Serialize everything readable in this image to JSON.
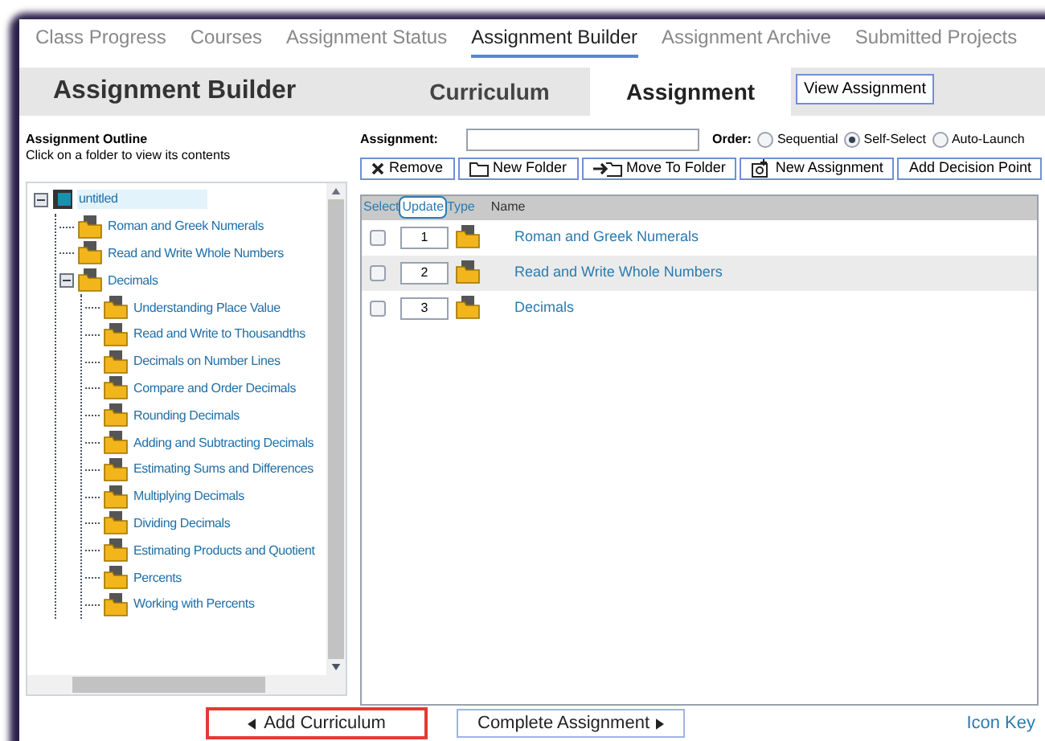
{
  "nav_tabs": [
    {
      "label": "Class Progress",
      "selected": false
    },
    {
      "label": "Courses",
      "selected": false
    },
    {
      "label": "Assignment Status",
      "selected": false
    },
    {
      "label": "Assignment Builder",
      "selected": true
    },
    {
      "label": "Assignment Archive",
      "selected": false
    },
    {
      "label": "Submitted Projects",
      "selected": false
    }
  ],
  "header": {
    "title": "Assignment Builder",
    "steps": [
      {
        "label": "Curriculum",
        "selected": false
      },
      {
        "label": "Assignment",
        "selected": true
      }
    ],
    "view_button": "View Assignment"
  },
  "outline": {
    "title": "Assignment Outline",
    "hint": "Click on a folder to view its contents",
    "tree": [
      {
        "label": "untitled",
        "kind": "root",
        "selected": true,
        "expanded": true,
        "children": [
          {
            "label": "Roman and Greek Numerals",
            "kind": "folder",
            "selected": false
          },
          {
            "label": "Read and Write Whole Numbers",
            "kind": "folder",
            "selected": false
          },
          {
            "label": "Decimals",
            "kind": "folder",
            "selected": false,
            "expanded": true,
            "children": [
              {
                "label": "Understanding Place Value",
                "kind": "folder",
                "selected": false
              },
              {
                "label": "Read and Write to Thousandths",
                "kind": "folder",
                "selected": false
              },
              {
                "label": "Decimals on Number Lines",
                "kind": "folder",
                "selected": false
              },
              {
                "label": "Compare and Order Decimals",
                "kind": "folder",
                "selected": false
              },
              {
                "label": "Rounding Decimals",
                "kind": "folder",
                "selected": false
              },
              {
                "label": "Adding and Subtracting Decimals",
                "kind": "folder",
                "selected": false
              },
              {
                "label": "Estimating Sums and Differences",
                "kind": "folder",
                "selected": false
              },
              {
                "label": "Multiplying Decimals",
                "kind": "folder",
                "selected": false
              },
              {
                "label": "Dividing Decimals",
                "kind": "folder",
                "selected": false
              },
              {
                "label": "Estimating Products and Quotient",
                "kind": "folder",
                "selected": false
              },
              {
                "label": "Percents",
                "kind": "folder",
                "selected": false
              },
              {
                "label": "Working with Percents",
                "kind": "folder",
                "selected": false
              }
            ]
          }
        ]
      }
    ]
  },
  "assignment": {
    "label": "Assignment:",
    "order_label": "Order:",
    "order_options": [
      {
        "label": "Sequential",
        "selected": false
      },
      {
        "label": "Self-Select",
        "selected": true
      },
      {
        "label": "Auto-Launch",
        "selected": false
      }
    ]
  },
  "toolbar": [
    {
      "label": "Remove"
    },
    {
      "label": "New Folder"
    },
    {
      "label": "Move To Folder"
    },
    {
      "label": "New Assignment"
    },
    {
      "label": "Add Decision Point"
    }
  ],
  "table": {
    "columns": [
      "Select",
      "Update",
      "Type",
      "Name"
    ],
    "rows": [
      {
        "order": "1",
        "name": "Roman and Greek Numerals",
        "checked": false,
        "selected": false
      },
      {
        "order": "2",
        "name": "Read and Write Whole Numbers",
        "checked": false,
        "selected": true
      },
      {
        "order": "3",
        "name": "Decimals",
        "checked": false,
        "selected": false
      }
    ]
  },
  "footer": {
    "back_button": "Add Curriculum",
    "next_button": "Complete Assignment",
    "link": "Icon Key"
  }
}
